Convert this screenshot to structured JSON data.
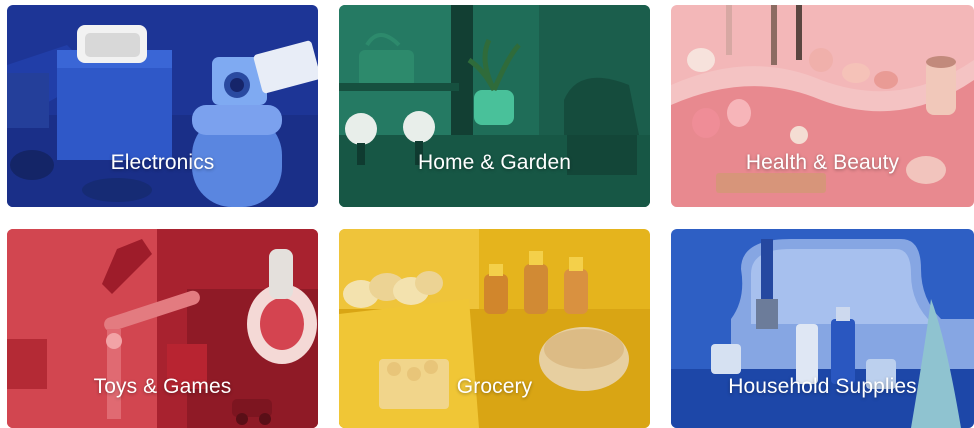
{
  "categories": [
    {
      "label": "Electronics",
      "color": "#1f3fa6"
    },
    {
      "label": "Home & Garden",
      "color": "#1f6e58"
    },
    {
      "label": "Health & Beauty",
      "color": "#ef9fa3"
    },
    {
      "label": "Toys & Games",
      "color": "#c7323e"
    },
    {
      "label": "Grocery",
      "color": "#e2b21b"
    },
    {
      "label": "Household Supplies",
      "color": "#2750b0"
    }
  ]
}
